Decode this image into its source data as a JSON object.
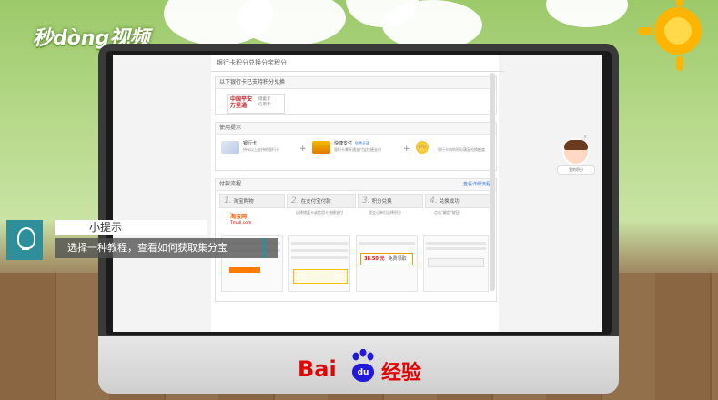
{
  "watermark": {
    "brand": "秒dòng视频"
  },
  "page": {
    "header_title": "银行卡积分兑换分宝积分",
    "banks_section": {
      "title": "以下银行卡已支持积分兑换",
      "bank": {
        "name": "中国平安 万里通",
        "cards": [
          "储蓄卡",
          "信用卡"
        ]
      }
    },
    "usage_section": {
      "title": "使用提示",
      "items": [
        {
          "title": "银行卡",
          "desc": "持有以上支持的银行卡",
          "tag": ""
        },
        {
          "title": "快捷支付",
          "desc": "银行卡需开通支付宝快捷支付",
          "tag": "免费开通"
        },
        {
          "title": "",
          "desc": "银行卡内的积分满足兑换额度",
          "tag": ""
        }
      ],
      "coin_label": "积分"
    },
    "flow_section": {
      "title": "付款流程",
      "link": "查看详细流程",
      "steps": [
        {
          "num": "1.",
          "label": "淘宝购物"
        },
        {
          "num": "2.",
          "label": "在支付宝付款"
        },
        {
          "num": "3.",
          "label": "积分兑换"
        },
        {
          "num": "4.",
          "label": "兑换成功"
        }
      ],
      "step_descs": [
        "选择储蓄卡或信用卡快捷支付",
        "提交订单后选择积分",
        "点击\"确定\"按钮"
      ],
      "taobao": "淘宝网",
      "tmall": "Tmall.com",
      "amount": "38.50 元",
      "confirm": "免费领取"
    }
  },
  "sidebar": {
    "label": "我的积分",
    "close": "×"
  },
  "tip": {
    "label": "小提示",
    "text": "选择一种教程，查看如何获取集分宝"
  },
  "footer": {
    "brand_left": "Bai",
    "brand_du": "du",
    "brand_right": "经验"
  }
}
